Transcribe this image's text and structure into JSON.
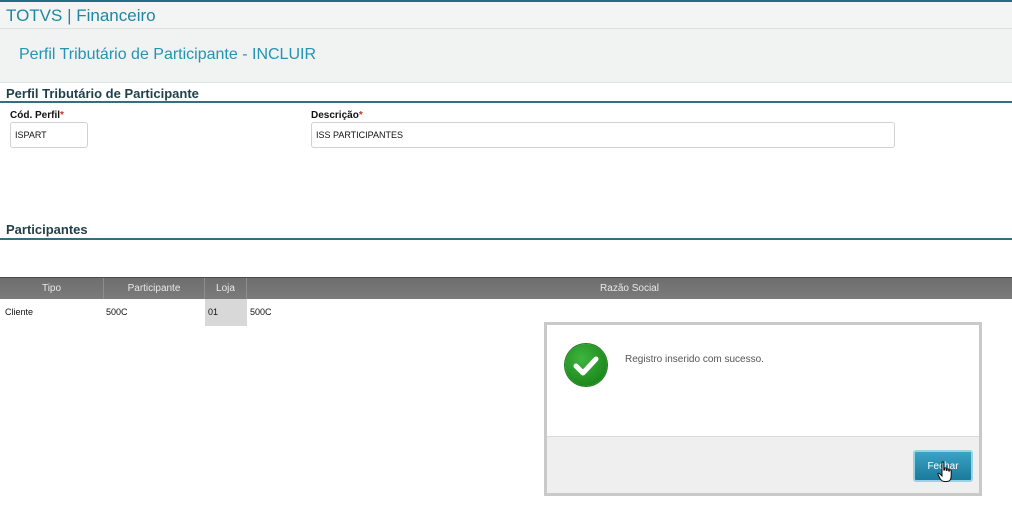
{
  "app": {
    "title": "TOTVS | Financeiro"
  },
  "page": {
    "title": "Perfil Tributário de Participante - INCLUIR"
  },
  "profile_section": {
    "title": "Perfil Tributário de Participante",
    "code_label": "Cód. Perfil",
    "code_value": "ISPART",
    "description_label": "Descrição",
    "description_value": "ISS PARTICIPANTES",
    "required_mark": "*"
  },
  "participants_section": {
    "title": "Participantes",
    "columns": [
      "Tipo",
      "Participante",
      "Loja",
      "Razão Social"
    ],
    "rows": [
      {
        "tipo": "Cliente",
        "participante": "500C",
        "loja": "01",
        "razao_social": "500C"
      }
    ]
  },
  "dialog": {
    "message": "Registro inserido com sucesso.",
    "close_label": "Fechar",
    "icon": "check-circle-icon"
  },
  "colors": {
    "accent": "#2593b1",
    "success": "#2a9d2a",
    "grid_header": "#747474",
    "section_line": "#356f7d"
  }
}
